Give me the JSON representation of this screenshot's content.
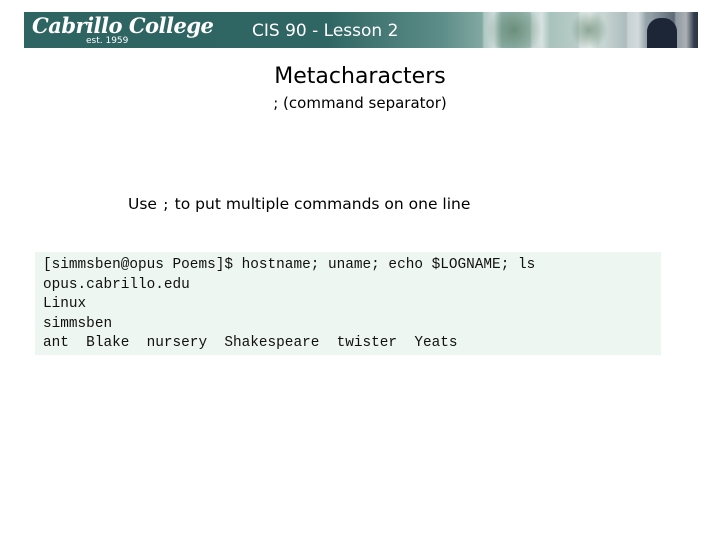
{
  "header": {
    "logo_text": "Cabrillo College",
    "logo_subtext": "est. 1959",
    "lesson_title": "CIS 90 - Lesson 2"
  },
  "slide": {
    "title": "Metacharacters",
    "subtitle": "; (command separator)",
    "instruction": {
      "prefix": "Use",
      "code": ";",
      "suffix": "to put multiple commands on one line"
    }
  },
  "terminal": {
    "lines": [
      "[simmsben@opus Poems]$ hostname; uname; echo $LOGNAME; ls",
      "opus.cabrillo.edu",
      "Linux",
      "simmsben",
      "ant  Blake  nursery  Shakespeare  twister  Yeats"
    ]
  }
}
